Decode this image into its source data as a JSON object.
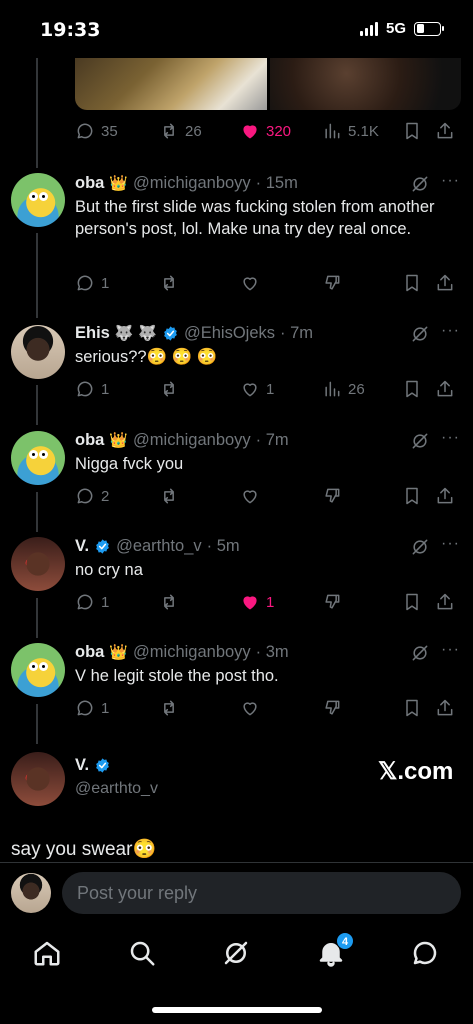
{
  "status": {
    "time": "19:33",
    "network": "5G"
  },
  "original_post": {
    "replies": "35",
    "reposts": "26",
    "likes": "320",
    "views": "5.1K"
  },
  "replies": [
    {
      "name": "oba",
      "badge_emoji": "👑",
      "handle": "@michiganboyy",
      "time": "· 15m",
      "text": "But the first slide was fucking stolen from another person's post, lol. Make una try dey real once.",
      "replies": "1",
      "reposts": "",
      "likes": "",
      "views": ""
    },
    {
      "name": "Ehis",
      "badge_emoji": "🐺 🐺",
      "handle": "@EhisOjeks",
      "time": "· 7m",
      "text": "serious??😳 😳 😳",
      "replies": "1",
      "reposts": "",
      "likes": "1",
      "views": "26"
    },
    {
      "name": "oba",
      "badge_emoji": "👑",
      "handle": "@michiganboyy",
      "time": "· 7m",
      "text": "Nigga fvck you",
      "replies": "2",
      "reposts": "",
      "likes": "",
      "views": ""
    },
    {
      "name": "V.",
      "badge_emoji": "",
      "handle": "@earthto_v",
      "time": "· 5m",
      "text": "no cry na",
      "replies": "1",
      "reposts": "",
      "likes": "1",
      "views": ""
    },
    {
      "name": "oba",
      "badge_emoji": "👑",
      "handle": "@michiganboyy",
      "time": "· 3m",
      "text": "V he legit stole the post tho.",
      "replies": "1",
      "reposts": "",
      "likes": "",
      "views": ""
    }
  ],
  "quoted": {
    "name": "V.",
    "handle": "@earthto_v",
    "watermark": "𝕏.com",
    "text": "say you swear😳"
  },
  "reply_bar": {
    "placeholder": "Post your reply"
  },
  "tabs": {
    "notifications_badge": "4"
  },
  "colors": {
    "like": "#f91880",
    "verified": "#1d9bf0",
    "muted": "#71767b"
  }
}
